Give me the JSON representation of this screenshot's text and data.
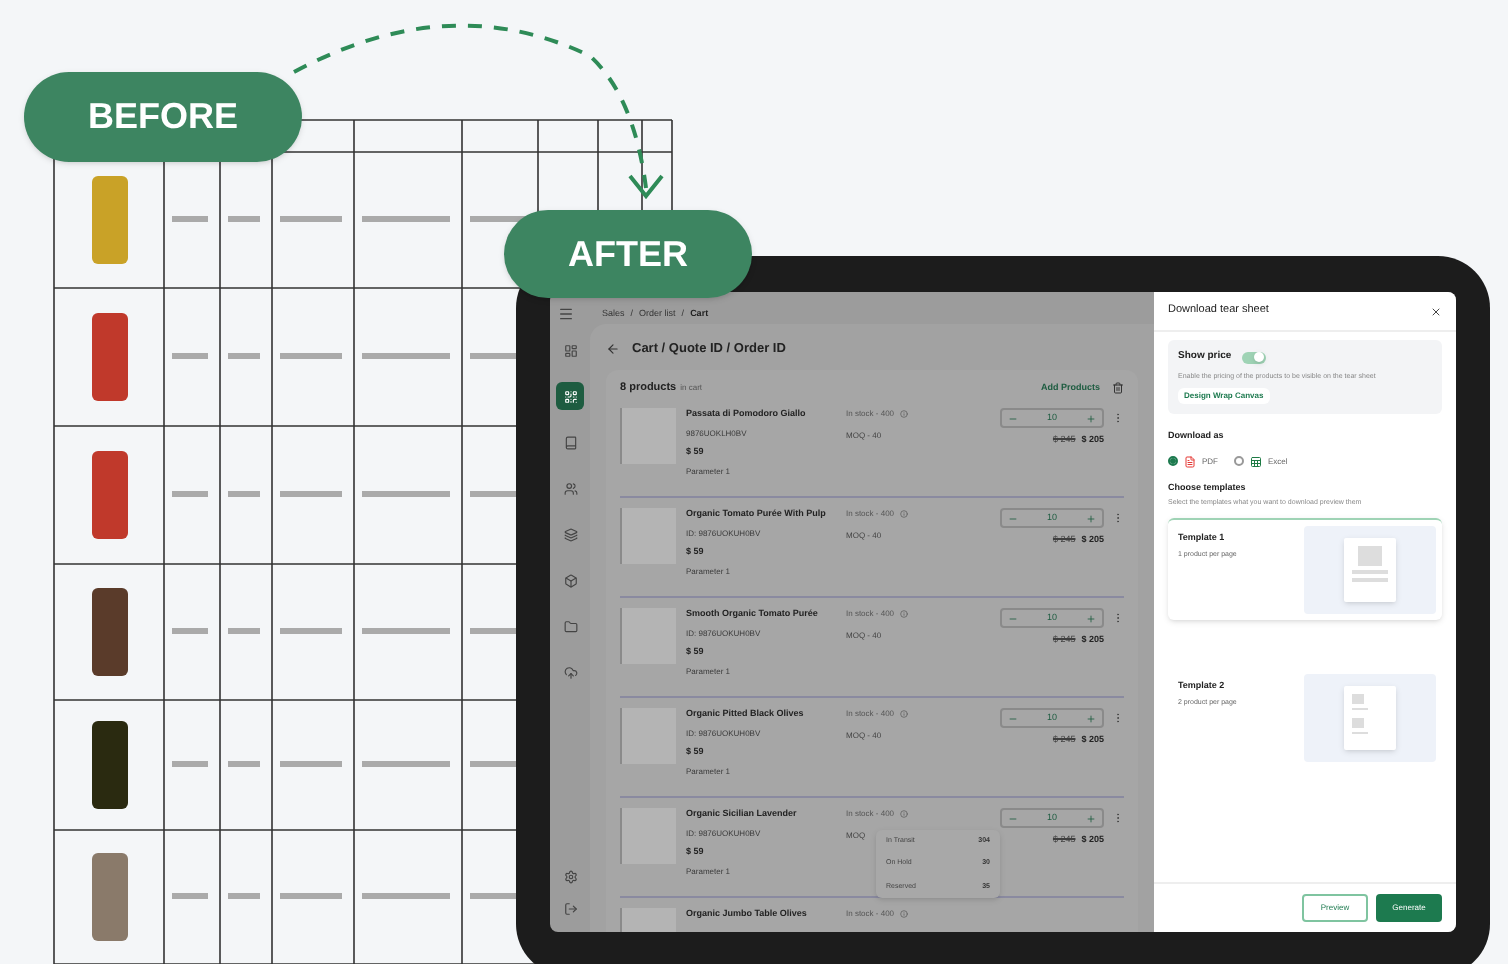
{
  "labels": {
    "before": "BEFORE",
    "after": "AFTER"
  },
  "nav": [
    {
      "selected": false
    },
    {
      "selected": true
    },
    {
      "selected": false
    },
    {
      "selected": false
    },
    {
      "selected": false
    },
    {
      "selected": false
    },
    {
      "selected": false
    },
    {
      "selected": false
    }
  ],
  "breadcrumb": [
    "Sales",
    "/",
    "Order list",
    "/",
    "Cart"
  ],
  "page_title": "Cart / Quote ID / Order ID",
  "cart": {
    "count": "8 products",
    "suffix": "in cart",
    "add_button": "Add Products"
  },
  "products": [
    {
      "name": "Passata di Pomodoro Giallo",
      "id": "9876UOKLH0BV",
      "price": "$ 59",
      "param": "Parameter 1",
      "stock": "In stock - 400",
      "moq": "MOQ - 40",
      "qty": "10",
      "old_price": "$ 245",
      "new_price": "$ 205"
    },
    {
      "name": "Organic Tomato Purée With Pulp",
      "id": "ID: 9876UOKUH0BV",
      "price": "$ 59",
      "param": "Parameter 1",
      "stock": "In stock - 400",
      "moq": "MOQ - 40",
      "qty": "10",
      "old_price": "$ 245",
      "new_price": "$ 205"
    },
    {
      "name": "Smooth Organic Tomato Purée",
      "id": "ID: 9876UOKUH0BV",
      "price": "$ 59",
      "param": "Parameter 1",
      "stock": "In stock - 400",
      "moq": "MOQ - 40",
      "qty": "10",
      "old_price": "$ 245",
      "new_price": "$ 205"
    },
    {
      "name": "Organic Pitted Black Olives",
      "id": "ID: 9876UOKUH0BV",
      "price": "$ 59",
      "param": "Parameter 1",
      "stock": "In stock - 400",
      "moq": "MOQ - 40",
      "qty": "10",
      "old_price": "$ 245",
      "new_price": "$ 205"
    },
    {
      "name": "Organic Sicilian Lavender",
      "id": "ID: 9876UOKUH0BV",
      "price": "$ 59",
      "param": "Parameter 1",
      "stock": "In stock - 400",
      "moq": "MOQ",
      "qty": "10",
      "old_price": "$ 245",
      "new_price": "$ 205",
      "tooltip": [
        {
          "label": "In Transit",
          "value": "304"
        },
        {
          "label": "On Hold",
          "value": "30"
        },
        {
          "label": "Reserved",
          "value": "35"
        }
      ]
    },
    {
      "name": "Organic Jumbo Table Olives",
      "stock": "In stock - 400"
    }
  ],
  "drawer": {
    "title": "Download tear sheet",
    "show_price": {
      "label": "Show price",
      "on": true,
      "description": "Enable the pricing of the products to be visible on the tear sheet",
      "link": "Design Wrap Canvas"
    },
    "download_as": {
      "label": "Download as",
      "options": [
        {
          "label": "PDF",
          "kind": "pdf",
          "selected": true
        },
        {
          "label": "Excel",
          "kind": "excel",
          "selected": false
        }
      ]
    },
    "templates": {
      "label": "Choose templates",
      "description": "Select the templates what you want to download preview them",
      "items": [
        {
          "name": "Template 1",
          "detail": "1 product per page",
          "kind": "single",
          "selected": true
        },
        {
          "name": "Template 2",
          "detail": "2 product per page",
          "kind": "double",
          "selected": false
        }
      ]
    },
    "buttons": [
      {
        "label": "Preview",
        "kind": "secondary"
      },
      {
        "label": "Generate",
        "kind": "primary"
      }
    ]
  }
}
